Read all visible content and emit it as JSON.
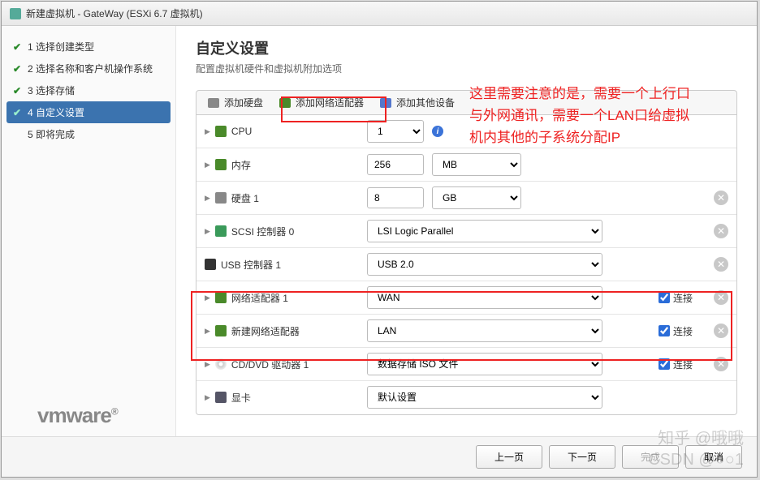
{
  "title": "新建虚拟机 - GateWay (ESXi 6.7 虚拟机)",
  "steps": {
    "s1": "1 选择创建类型",
    "s2": "2 选择名称和客户机操作系统",
    "s3": "3 选择存储",
    "s4": "4 自定义设置",
    "s5": "5 即将完成"
  },
  "main": {
    "title": "自定义设置",
    "subtitle": "配置虚拟机硬件和虚拟机附加选项"
  },
  "toolbar": {
    "hdd": "添加硬盘",
    "nic": "添加网络适配器",
    "other": "添加其他设备"
  },
  "rows": {
    "cpu": {
      "label": "CPU",
      "value": "1"
    },
    "mem": {
      "label": "内存",
      "value": "256",
      "unit": "MB"
    },
    "hdd": {
      "label": "硬盘 1",
      "value": "8",
      "unit": "GB"
    },
    "scsi": {
      "label": "SCSI 控制器 0",
      "value": "LSI Logic Parallel"
    },
    "usb": {
      "label": "USB 控制器 1",
      "value": "USB 2.0"
    },
    "nic1": {
      "label": "网络适配器 1",
      "value": "WAN",
      "connect": "连接"
    },
    "nic2": {
      "label": "新建网络适配器",
      "value": "LAN",
      "connect": "连接"
    },
    "cd": {
      "label": "CD/DVD 驱动器 1",
      "value": "数据存储 ISO 文件",
      "connect": "连接"
    },
    "gpu": {
      "label": "显卡",
      "value": "默认设置"
    }
  },
  "footer": {
    "prev": "上一页",
    "next": "下一页",
    "finish": "完成",
    "cancel": "取消"
  },
  "note": {
    "l1": "这里需要注意的是，需要一个上行口",
    "l2": "与外网通讯，需要一个LAN口给虚拟",
    "l3": "机内其他的子系统分配IP"
  },
  "logo": "vmware",
  "wm": {
    "l1": "知乎 @哦哦",
    "l2": "CSDN @○○1"
  }
}
